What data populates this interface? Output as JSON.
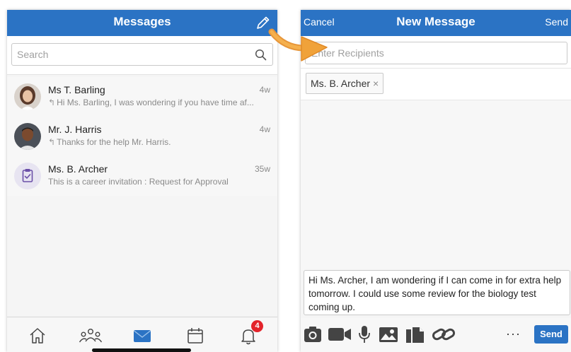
{
  "left": {
    "header_title": "Messages",
    "search_placeholder": "Search",
    "conversations": [
      {
        "name": "Ms T. Barling",
        "time": "4w",
        "preview": "Hi Ms. Barling, I was wondering if you have time af..."
      },
      {
        "name": "Mr. J. Harris",
        "time": "4w",
        "preview": "Thanks for the help Mr. Harris."
      },
      {
        "name": "Ms. B. Archer",
        "time": "35w",
        "preview": "This is a career invitation : Request for Approval"
      }
    ],
    "notification_count": "4"
  },
  "right": {
    "cancel_label": "Cancel",
    "header_title": "New Message",
    "send_label": "Send",
    "recipients_placeholder": "Enter Recipients",
    "recipient_chip": "Ms. B. Archer",
    "chip_remove": "×",
    "message_text": "Hi Ms. Archer, I am wondering if I can come in for extra help tomorrow. I could use some review for the biology test coming up.",
    "more_label": "···",
    "send_button": "Send"
  },
  "colors": {
    "accent": "#2b73c4",
    "badge": "#e3242b",
    "arrow": "#f0a23a"
  },
  "icons": [
    "edit-icon",
    "search-icon",
    "reply-icon",
    "home-icon",
    "groups-icon",
    "mail-icon",
    "calendar-icon",
    "bell-icon",
    "camera-icon",
    "video-icon",
    "mic-icon",
    "image-icon",
    "files-icon",
    "link-icon"
  ]
}
